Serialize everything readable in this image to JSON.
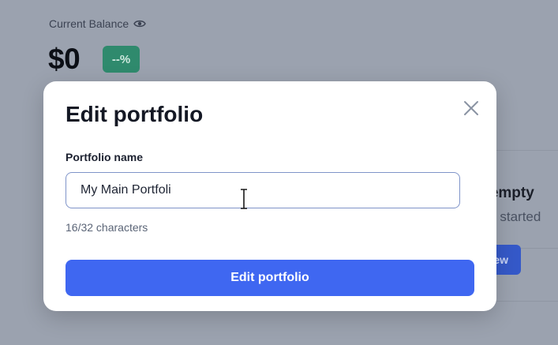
{
  "background": {
    "balance_label": "Current Balance",
    "balance_amount": "$0",
    "change_badge": "--%",
    "empty_title": "s empty",
    "empty_subtitle": "get started",
    "button_fragment": "ew"
  },
  "modal": {
    "title": "Edit portfolio",
    "field_label": "Portfolio name",
    "field_value": "My Main Portfoli",
    "char_count": "16/32 characters",
    "submit_label": "Edit portfolio"
  },
  "colors": {
    "primary": "#3f67f1",
    "badge_green": "#2f8a6d",
    "overlay": "#9ba2af"
  },
  "icons": {
    "visibility": "eye-icon",
    "close": "close-icon",
    "cursor": "text-cursor-icon"
  }
}
